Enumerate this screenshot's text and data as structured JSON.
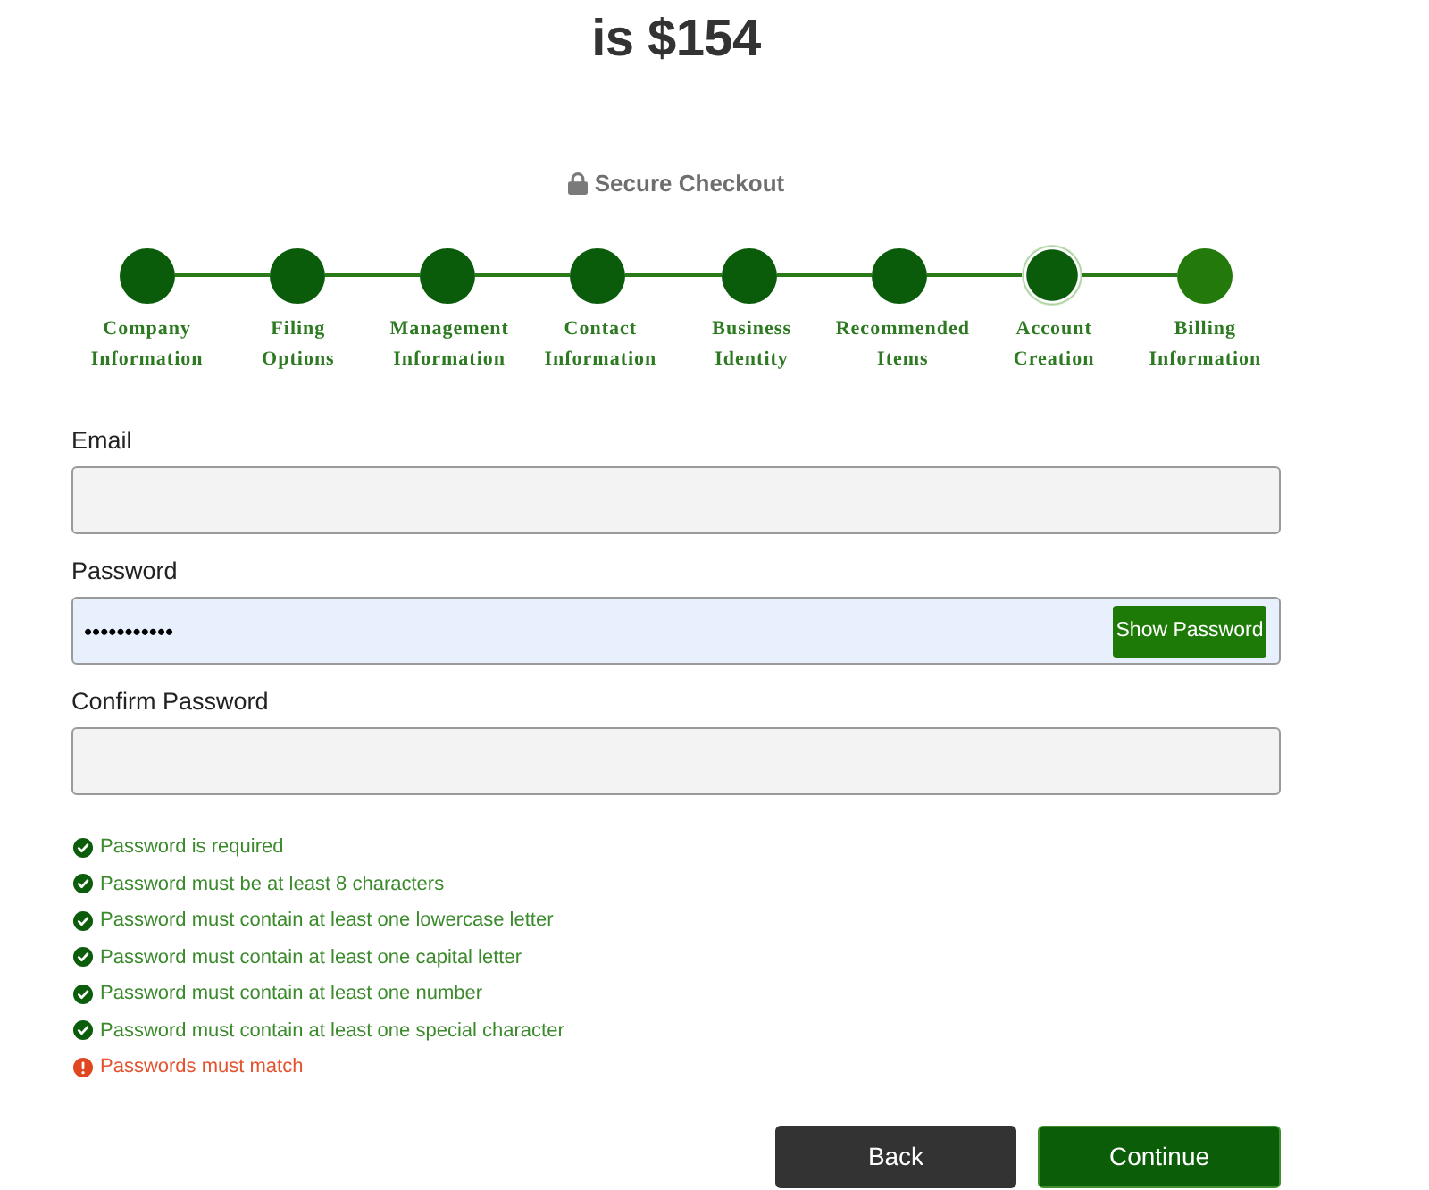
{
  "header": {
    "price_heading": "is $154",
    "secure_label": "Secure Checkout"
  },
  "steps": [
    {
      "label": "Company Information",
      "reached": true,
      "selected": false
    },
    {
      "label": "Filing Options",
      "reached": true,
      "selected": false
    },
    {
      "label": "Management Information",
      "reached": true,
      "selected": false
    },
    {
      "label": "Contact Information",
      "reached": true,
      "selected": false
    },
    {
      "label": "Business Identity",
      "reached": true,
      "selected": false
    },
    {
      "label": "Recommended Items",
      "reached": true,
      "selected": false
    },
    {
      "label": "Account Creation",
      "reached": true,
      "selected": true
    },
    {
      "label": "Billing Information",
      "reached": false,
      "selected": false
    }
  ],
  "form": {
    "fields": [
      {
        "label": "Email"
      },
      {
        "label": "Password",
        "value": "•••••••••••",
        "action": "Show Password"
      },
      {
        "label": "Confirm Password"
      }
    ]
  },
  "rules": [
    {
      "text": "Password is required",
      "met": true
    },
    {
      "text": "Password must be at least 8 characters",
      "met": true
    },
    {
      "text": "Password must contain at least one lowercase letter",
      "met": true
    },
    {
      "text": "Password must contain at least one capital letter",
      "met": true
    },
    {
      "text": "Password must contain at least one number",
      "met": true
    },
    {
      "text": "Password must contain at least one special character",
      "met": true
    },
    {
      "text": "Passwords must match",
      "met": false
    }
  ],
  "buttons": [
    {
      "label": "Back",
      "kind": "back"
    },
    {
      "label": "Continue",
      "kind": "continue"
    }
  ]
}
